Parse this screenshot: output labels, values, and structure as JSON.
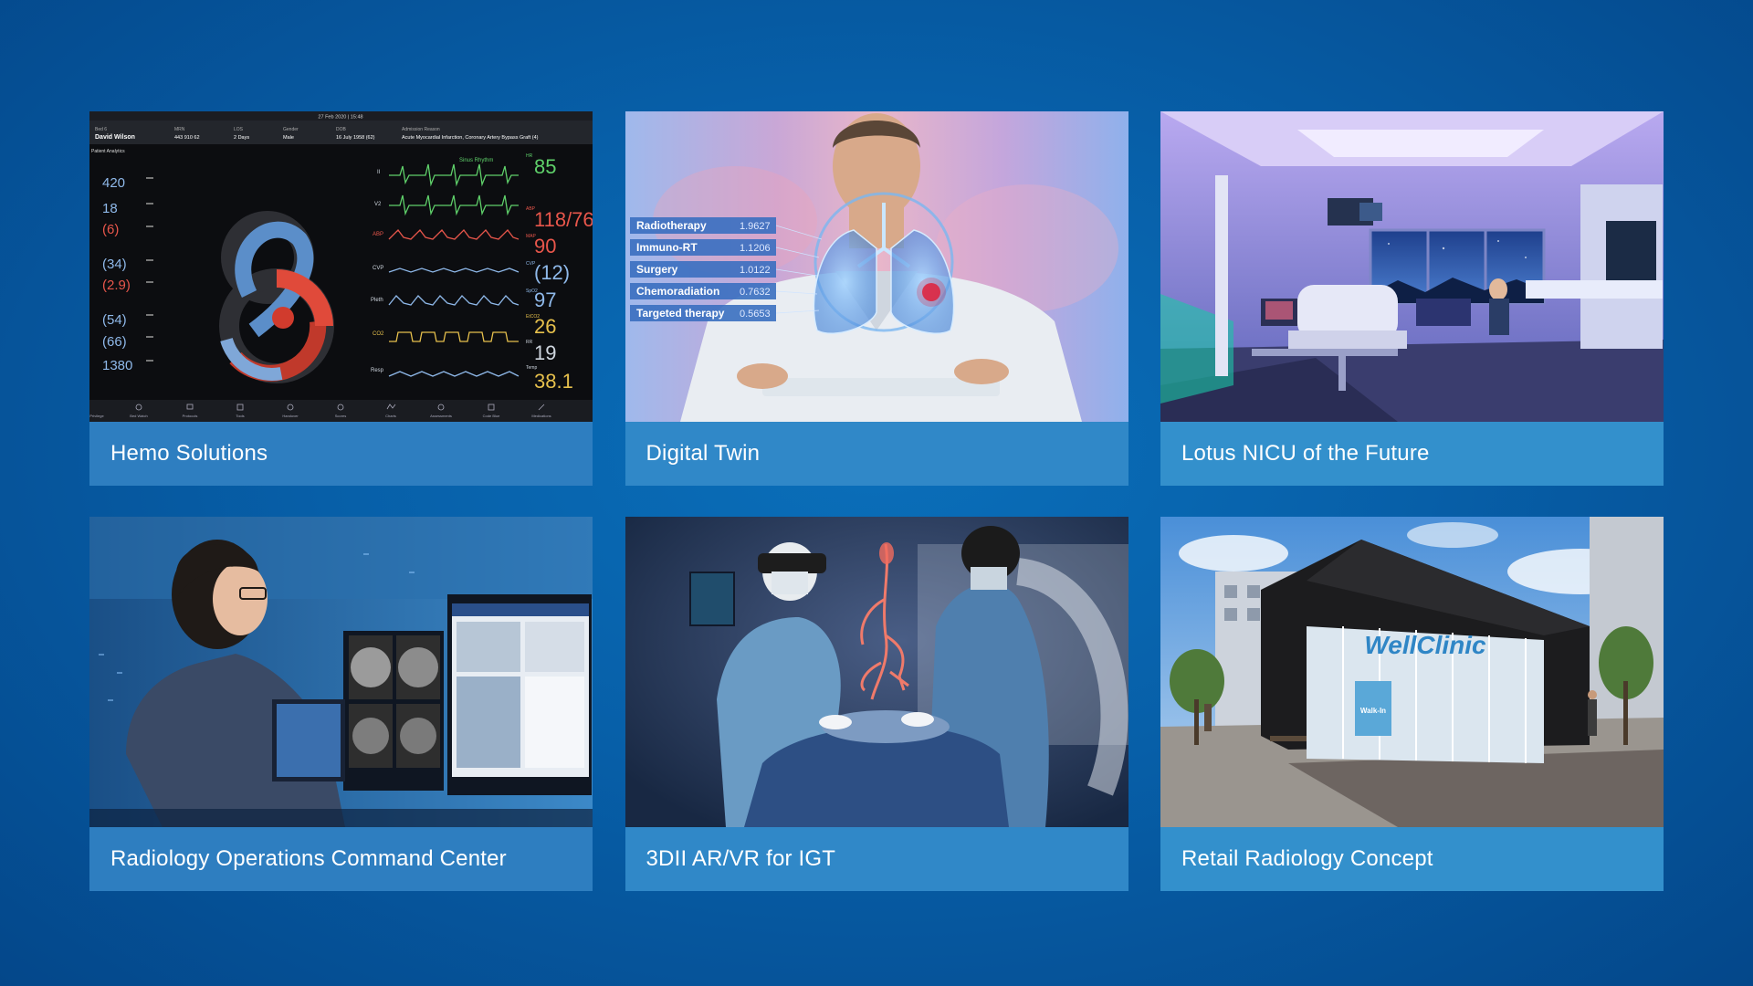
{
  "tiles": [
    {
      "caption": "Hemo Solutions",
      "image": "patient-monitor-dashboard",
      "monitor": {
        "top_date": "27 Feb 2020 | 15:48",
        "bed": "Bed 6",
        "patient_name": "David Wilson",
        "mrn_label": "MRN",
        "mrn": "443 910 62",
        "los_label": "LOS",
        "los": "2 Days",
        "gender_label": "Gender",
        "gender": "Male",
        "dob_label": "DOB",
        "dob": "16 July 1958 (62)",
        "admission_label": "Admission Reason",
        "admission": "Acute Myocardial Infarction, Coronary Artery Bypass Graft (4)",
        "analytics": "Patient Analytics",
        "left_values": [
          "420",
          "18",
          "(6)",
          "(34)",
          "(2.9)",
          "(54)",
          "(66)",
          "1380"
        ],
        "wave_labels": [
          "II",
          "V2",
          "ABP",
          "CVP",
          "Pleth",
          "CO2",
          "Resp"
        ],
        "rhythm": "Sinus Rhythm",
        "right_values": [
          "85",
          "118/76",
          "90",
          "(12)",
          "97",
          "26",
          "19",
          "38.1"
        ],
        "right_labels": [
          "HR",
          "ABP",
          "MAP",
          "CVP",
          "SpO2",
          "EtCO2",
          "RR",
          "Temp"
        ],
        "bottom_nav": [
          "Privilege",
          "Bed Watch",
          "Protocols",
          "Tools",
          "Handover",
          "Scores",
          "Charts",
          "Assessments",
          "Code Blue",
          "Medications"
        ]
      }
    },
    {
      "caption": "Digital Twin",
      "image": "doctor-with-holographic-lungs",
      "therapies": [
        {
          "label": "Radiotherapy",
          "value": "1.9627"
        },
        {
          "label": "Immuno-RT",
          "value": "1.1206"
        },
        {
          "label": "Surgery",
          "value": "1.0122"
        },
        {
          "label": "Chemoradiation",
          "value": "0.7632"
        },
        {
          "label": "Targeted therapy",
          "value": "0.5653"
        }
      ]
    },
    {
      "caption": "Lotus NICU of the Future",
      "image": "nicu-room-interior"
    },
    {
      "caption": "Radiology Operations Command Center",
      "image": "radiologist-at-monitors"
    },
    {
      "caption": "3DII AR/VR for IGT",
      "image": "surgeons-with-ar-headset"
    },
    {
      "caption": "Retail Radiology Concept",
      "image": "retail-clinic-storefront",
      "sign": "WellClinic",
      "door_sign": "Walk-In"
    }
  ],
  "colors": {
    "background": "#075fa8",
    "caption_bar": "#2e7ec0",
    "caption_text": "#ffffff"
  }
}
